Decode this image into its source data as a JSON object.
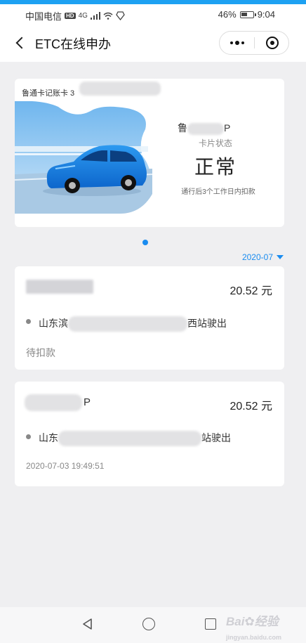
{
  "status_bar": {
    "carrier": "中国电信",
    "network_badge": "HD",
    "signal_text": "4G",
    "battery": "46%",
    "time": "9:04"
  },
  "nav": {
    "title": "ETC在线申办",
    "icons": {
      "back": "back-arrow-icon",
      "more": "more-dots-icon",
      "close": "close-miniprogram-icon"
    }
  },
  "card": {
    "card_type_label": "鲁通卡记账卡 3",
    "card_name_prefix": "鲁",
    "card_name_suffix": "P",
    "status_label": "卡片状态",
    "status": "正常",
    "note": "通行后3个工作日内扣款"
  },
  "month_selector": {
    "label": "2020-07"
  },
  "transactions": [
    {
      "plate": "",
      "amount": "20.52 元",
      "route_prefix": "山东滨",
      "route_suffix": "西站驶出",
      "footer": "待扣款"
    },
    {
      "plate": "P",
      "amount": "20.52 元",
      "route_prefix": "山东",
      "route_suffix": "站驶出",
      "footer": "2020-07-03 19:49:51"
    }
  ],
  "colors": {
    "accent": "#1a8cf0",
    "top_accent": "#1da1f2",
    "background": "#efeff1"
  },
  "watermark": {
    "brand": "Bai",
    "brand2": "经验",
    "url": "jingyan.baidu.com"
  }
}
